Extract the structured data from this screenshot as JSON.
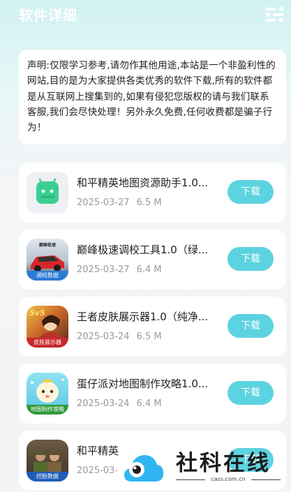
{
  "header": {
    "title": "软件详细",
    "menu_icon": "menu-icon"
  },
  "notice": {
    "text": "声明:仅限学习参考,请勿作其他用途,本站是一个非盈利性的网站,目的是为大家提供各类优秀的软件下载,所有的软件都是从互联网上搜集到的,如果有侵犯您版权的请与我们联系客服,我们会尽快处理！另外永久免费,任何收费都是骗子行为！"
  },
  "apps": [
    {
      "name": "和平精英地图资源助手1.0...",
      "date": "2025-03-27",
      "size": "6.5 M",
      "button": "下载",
      "icon": "android-app-icon",
      "badge": ""
    },
    {
      "name": "巅峰极速调校工具1.0（绿...",
      "date": "2025-03-27",
      "size": "6.4 M",
      "button": "下载",
      "icon": "racing-car-icon",
      "badge": "调校数据"
    },
    {
      "name": "王者皮肤展示器1.0（纯净...",
      "date": "2025-03-24",
      "size": "6.5 M",
      "button": "下载",
      "icon": "hero-skin-icon",
      "badge": "皮肤展示器"
    },
    {
      "name": "蛋仔派对地图制作攻略1.0...",
      "date": "2025-03-24",
      "size": "6.4 M",
      "button": "下载",
      "icon": "eggy-party-icon",
      "badge": "地图制作攻略"
    },
    {
      "name": "和平精英",
      "date": "2025-03-",
      "size": "",
      "button": "下载",
      "icon": "soldier-icon",
      "badge": "控脸数据"
    }
  ],
  "watermark": {
    "text": "社科在线",
    "url": "cass.com.cn"
  },
  "colors": {
    "accent": "#5cd3e0",
    "header_bg": "#d2f1f3",
    "title": "#ffffff",
    "meta_text": "#9a9a9a"
  }
}
